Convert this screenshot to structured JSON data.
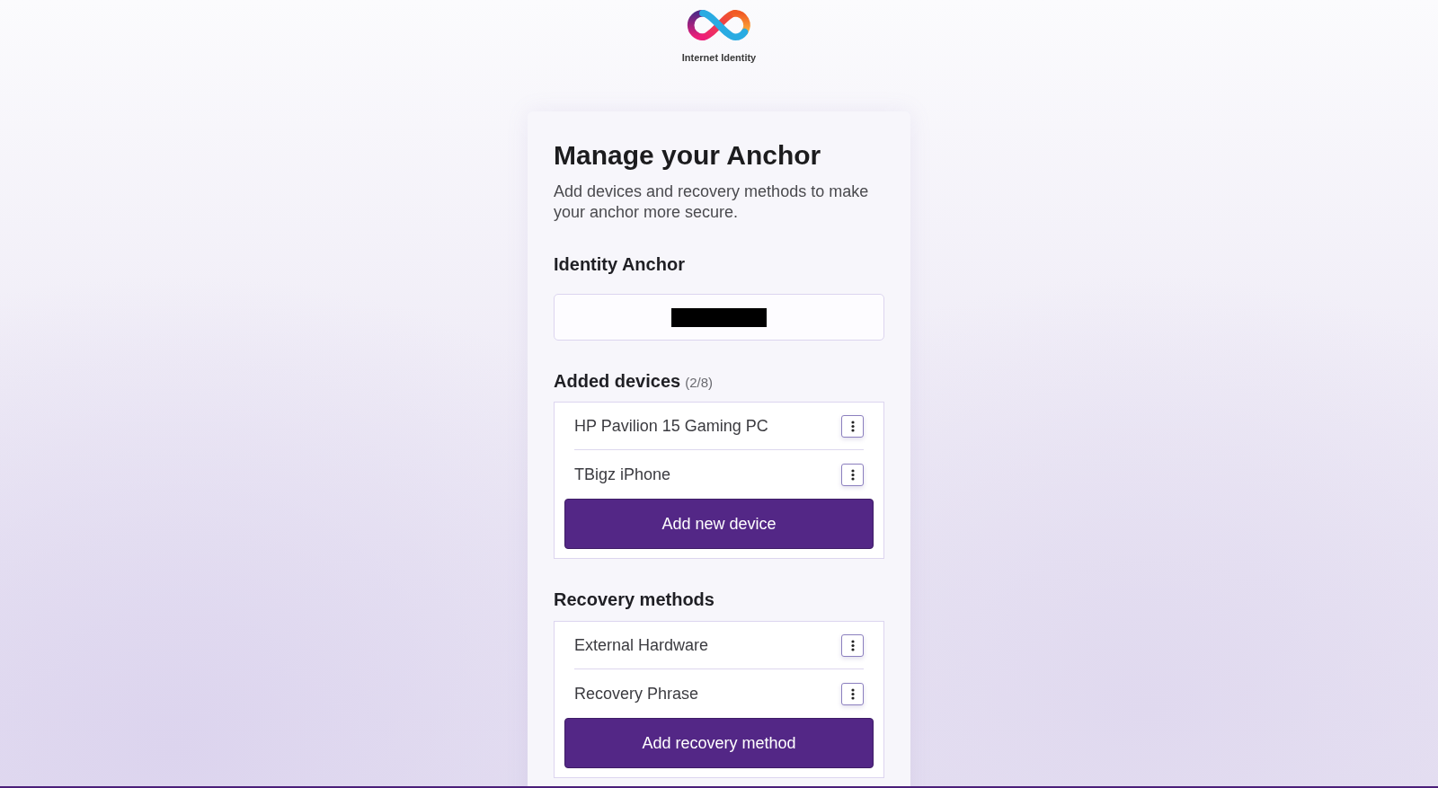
{
  "header": {
    "logo_text": "Internet Identity"
  },
  "card": {
    "title": "Manage your Anchor",
    "subtitle": "Add devices and recovery methods to make your anchor more secure.",
    "identity_anchor": {
      "label": "Identity Anchor",
      "value_redacted": true
    },
    "devices": {
      "heading": "Added devices",
      "count": "(2/8)",
      "items": [
        {
          "name": "HP Pavilion 15 Gaming PC"
        },
        {
          "name": "TBigz iPhone"
        }
      ],
      "button": "Add new device"
    },
    "recovery": {
      "heading": "Recovery methods",
      "items": [
        {
          "name": "External Hardware"
        },
        {
          "name": "Recovery Phrase"
        }
      ],
      "button": "Add recovery method"
    }
  }
}
